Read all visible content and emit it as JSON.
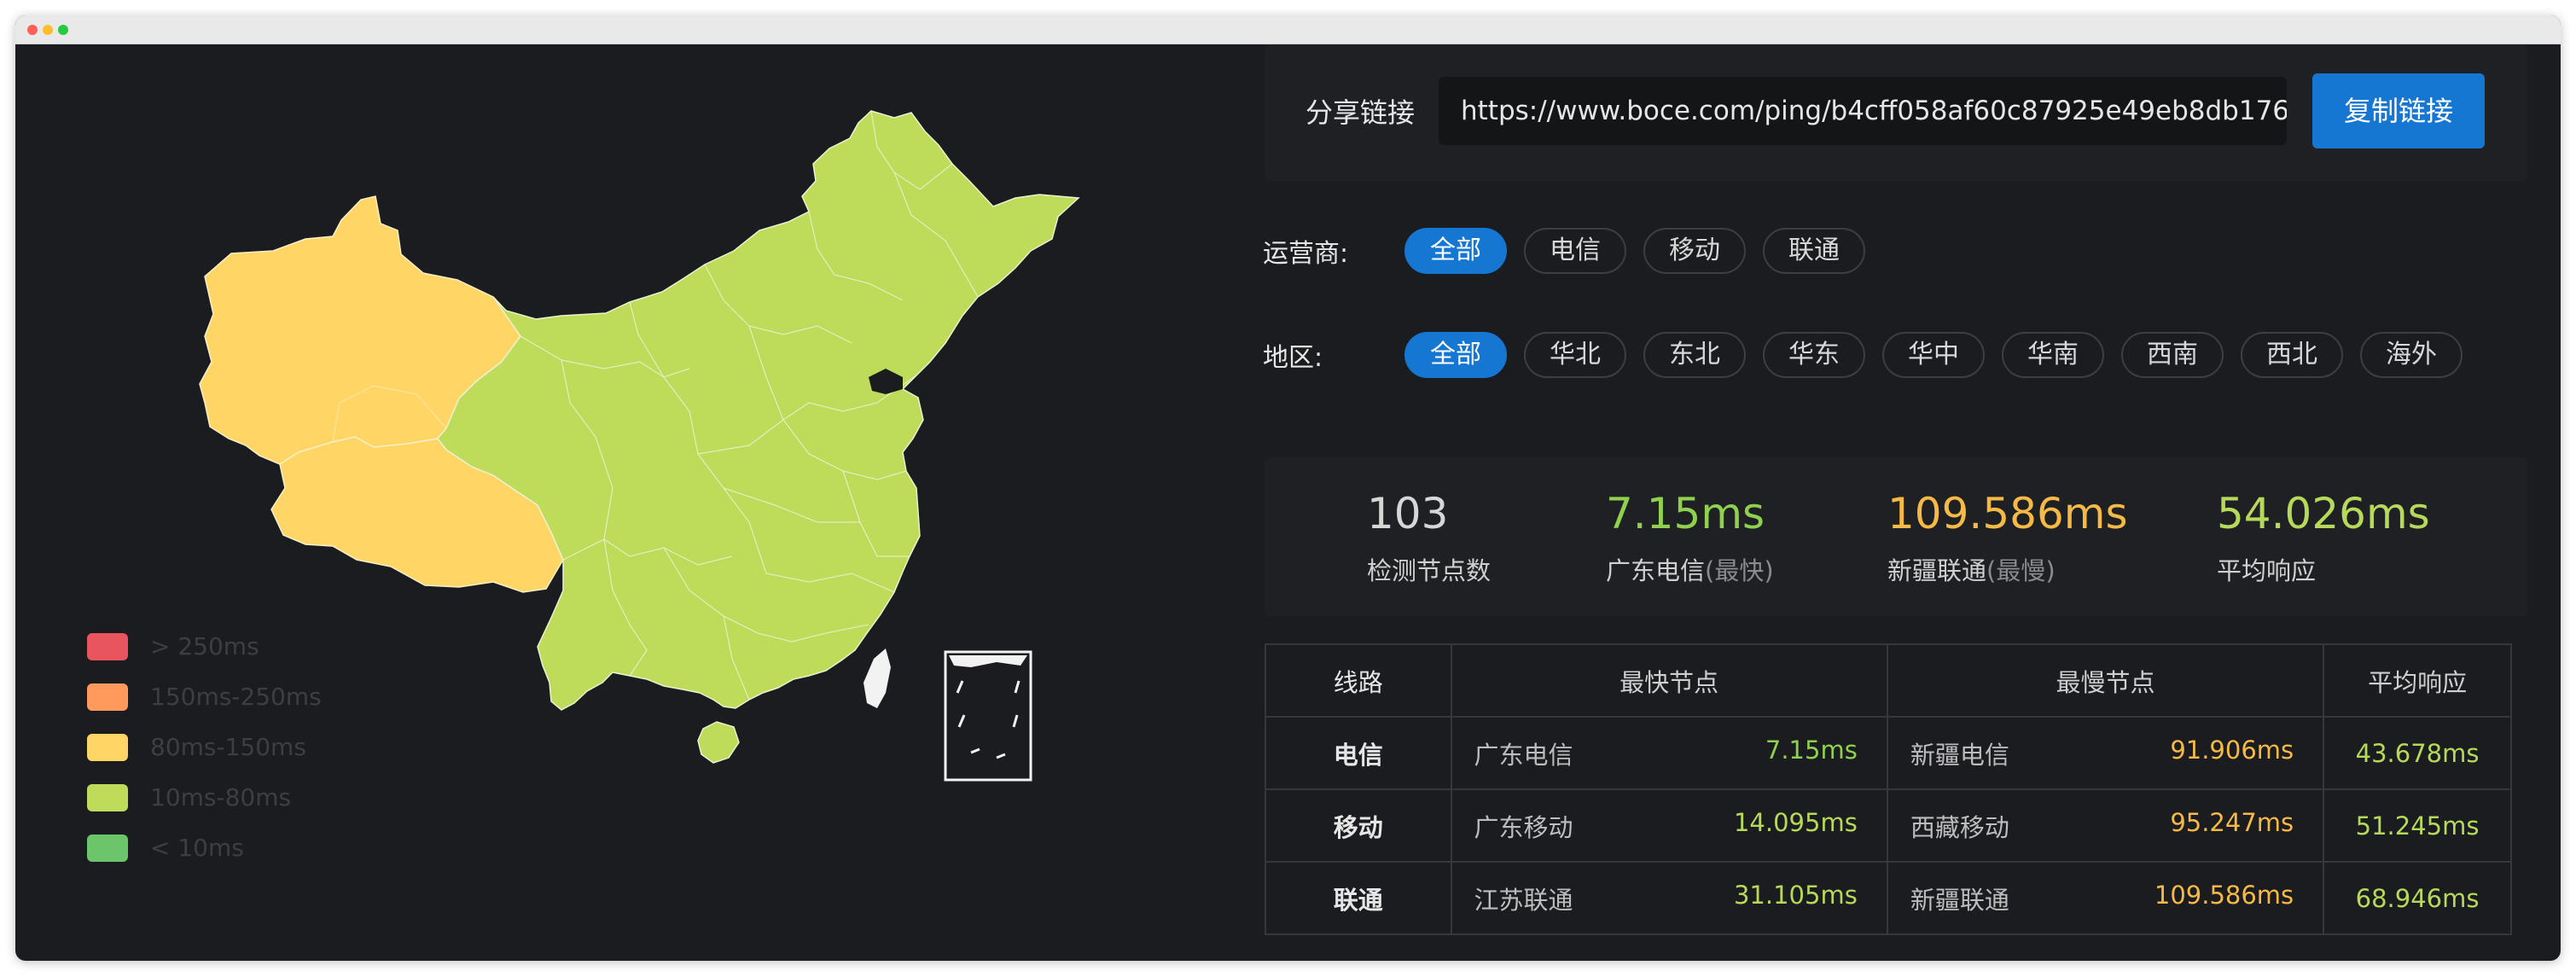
{
  "colors": {
    "over_250": "#e8555f",
    "ms_150_250": "#ff9a5c",
    "ms_80_150": "#ffd666",
    "ms_10_80": "#bedb5a",
    "under_10": "#6cc56a",
    "accent_blue": "#1677d3",
    "fast_green": "#8fd14f",
    "slow_orange": "#f5b945"
  },
  "legend": [
    {
      "label": "> 250ms",
      "color": "#e8555f"
    },
    {
      "label": "150ms-250ms",
      "color": "#ff9a5c"
    },
    {
      "label": "80ms-150ms",
      "color": "#ffd666"
    },
    {
      "label": "10ms-80ms",
      "color": "#bedb5a"
    },
    {
      "label": "< 10ms",
      "color": "#6cc56a"
    }
  ],
  "share": {
    "label": "分享链接",
    "url": "https://www.boce.com/ping/b4cff058af60c87925e49eb8db176",
    "copy_label": "复制链接"
  },
  "filters": {
    "isp_label": "运营商:",
    "isp_options": [
      "全部",
      "电信",
      "移动",
      "联通"
    ],
    "isp_selected": "全部",
    "region_label": "地区:",
    "region_options": [
      "全部",
      "华北",
      "东北",
      "华东",
      "华中",
      "华南",
      "西南",
      "西北",
      "海外"
    ],
    "region_selected": "全部"
  },
  "stats": {
    "nodes_value": "103",
    "nodes_label": "检测节点数",
    "fastest_value": "7.15ms",
    "fastest_label": "广东电信",
    "fastest_tag": "(最快)",
    "slowest_value": "109.586ms",
    "slowest_label": "新疆联通",
    "slowest_tag": "(最慢)",
    "avg_value": "54.026ms",
    "avg_label": "平均响应"
  },
  "table": {
    "headers": [
      "线路",
      "最快节点",
      "最慢节点",
      "平均响应"
    ],
    "rows": [
      {
        "line": "电信",
        "fast_node": "广东电信",
        "fast_time": "7.15ms",
        "slow_node": "新疆电信",
        "slow_time": "91.906ms",
        "avg": "43.678ms"
      },
      {
        "line": "移动",
        "fast_node": "广东移动",
        "fast_time": "14.095ms",
        "slow_node": "西藏移动",
        "slow_time": "95.247ms",
        "avg": "51.245ms"
      },
      {
        "line": "联通",
        "fast_node": "江苏联通",
        "fast_time": "31.105ms",
        "slow_node": "新疆联通",
        "slow_time": "109.586ms",
        "avg": "68.946ms"
      }
    ]
  }
}
